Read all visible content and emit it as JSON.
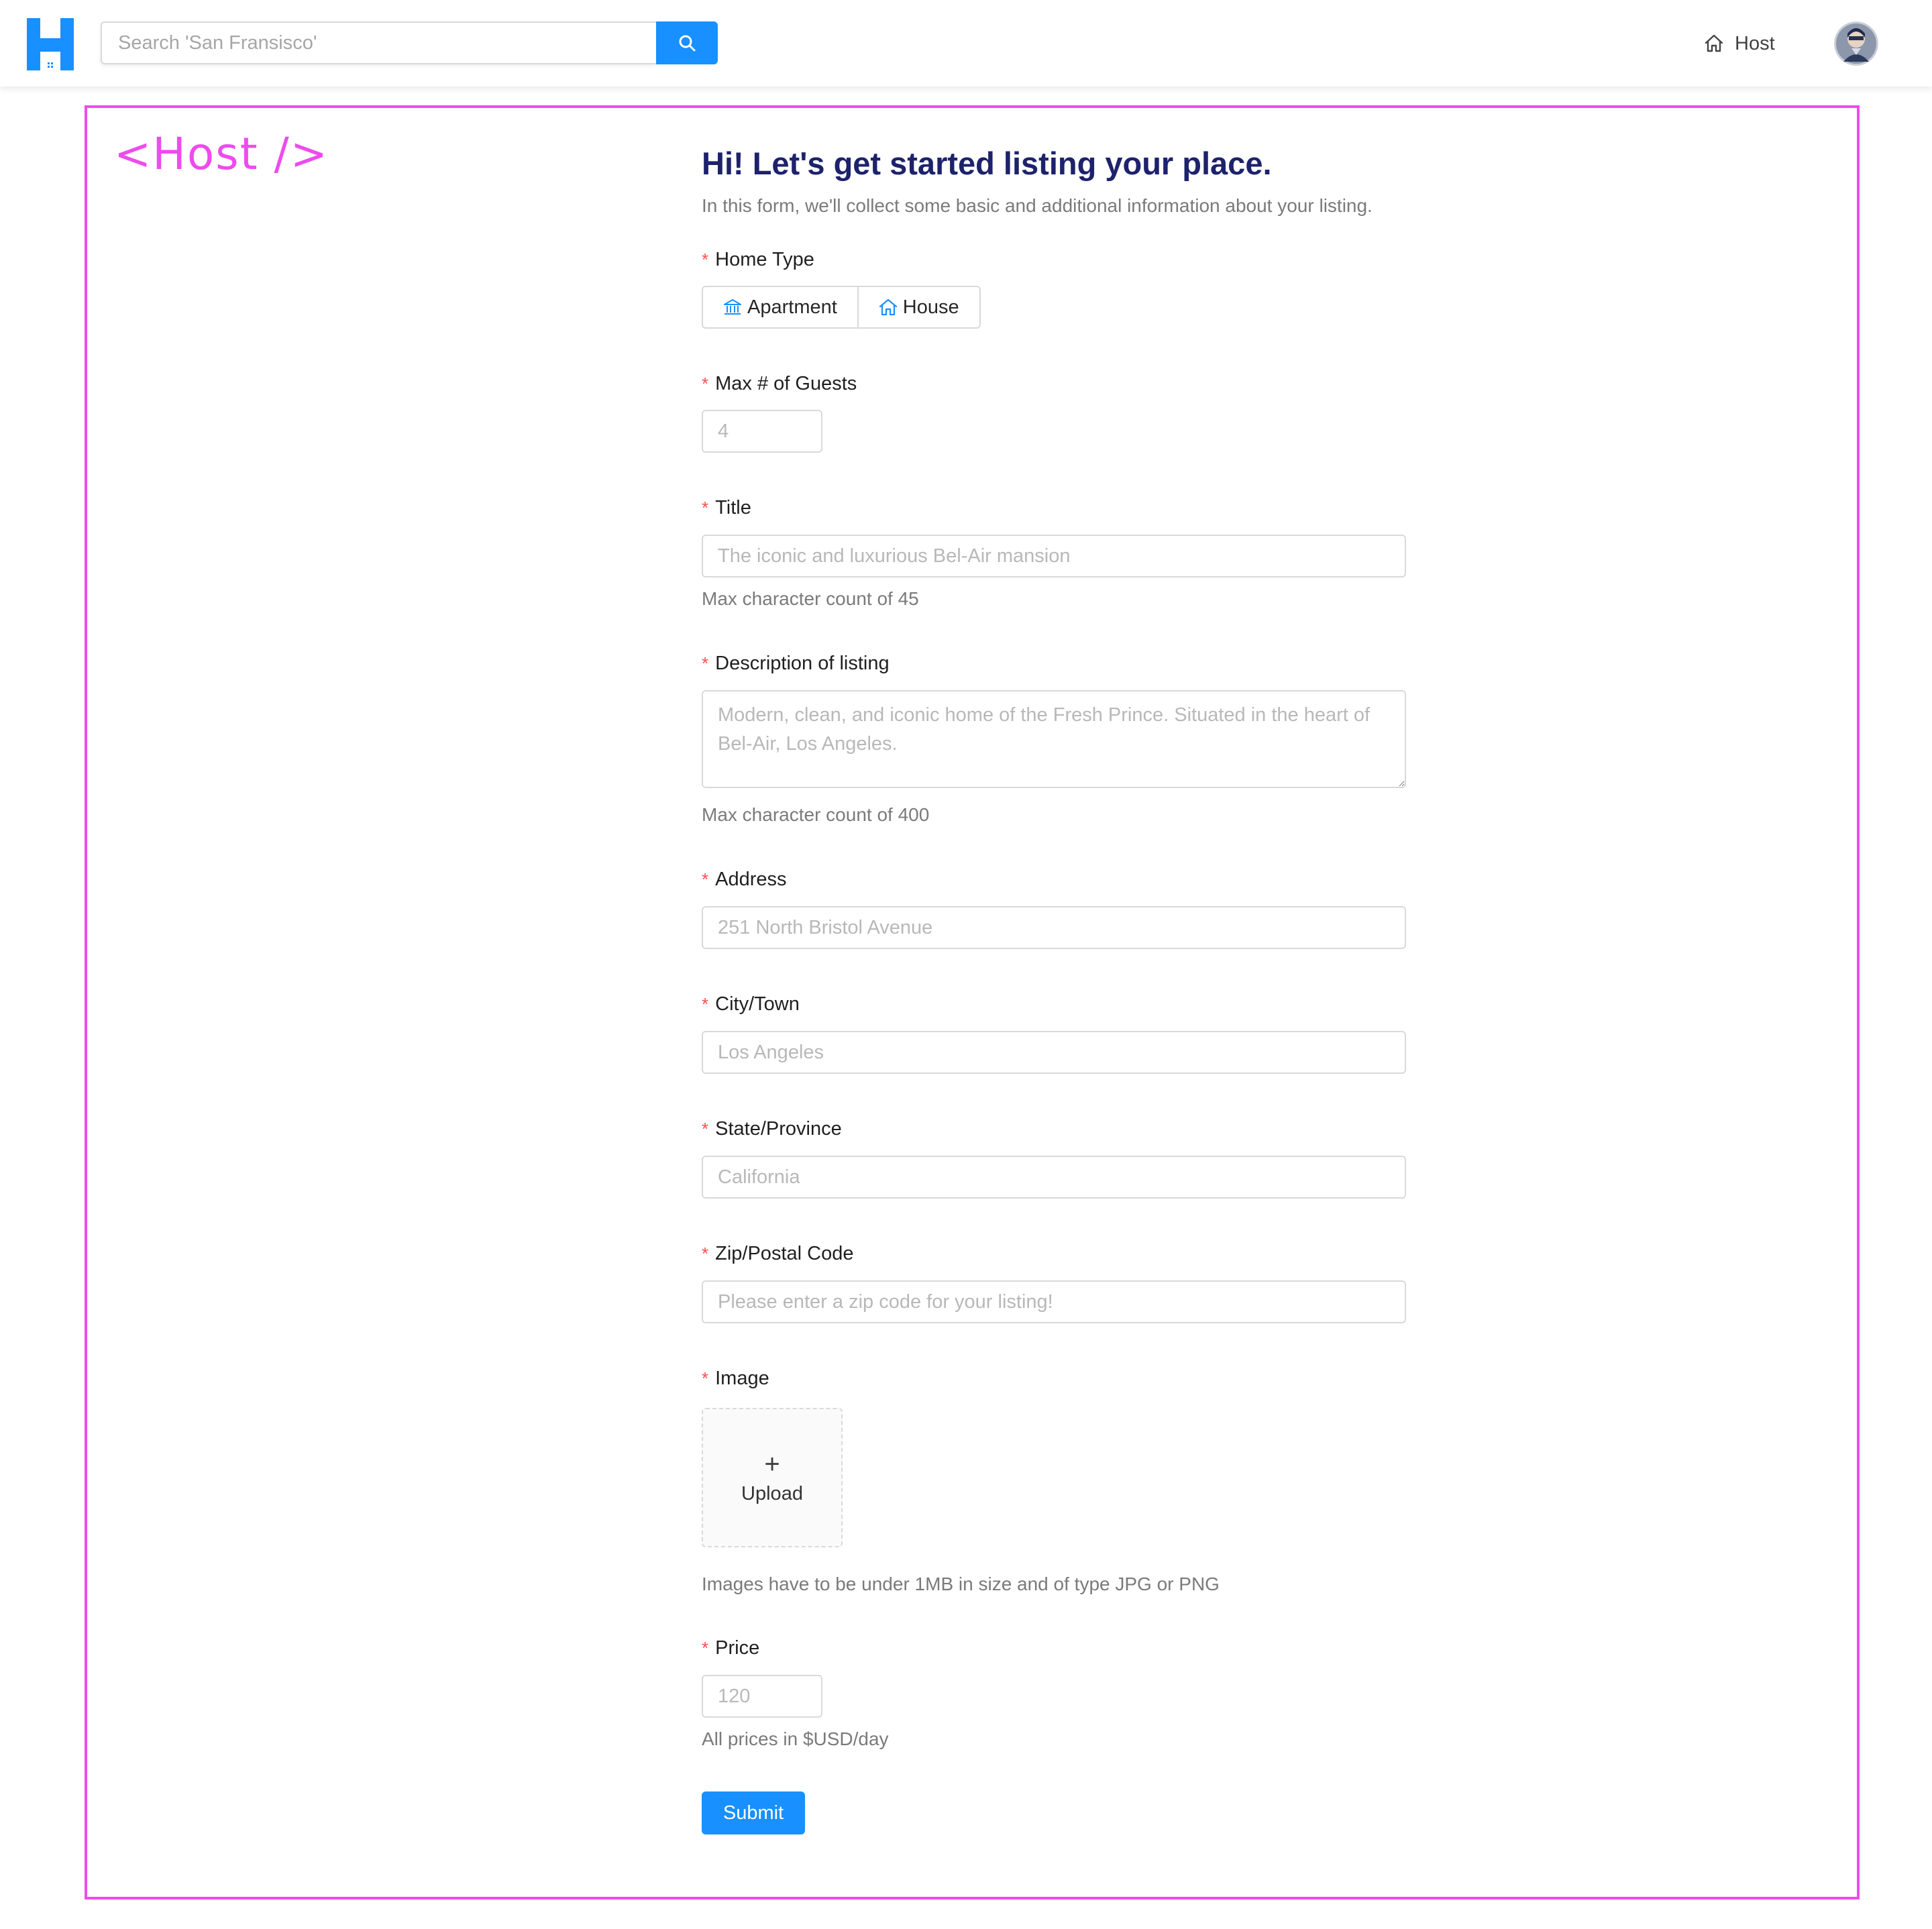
{
  "header": {
    "search": {
      "placeholder": "Search 'San Fransisco'"
    },
    "nav_host_label": "Host",
    "brand_color": "#1890ff"
  },
  "frame": {
    "host_tag": "<Host />",
    "frame_color": "#ee4bee"
  },
  "form": {
    "title": "Hi! Let's get started listing your place.",
    "subtitle": "In this form, we'll collect some basic and additional information about your listing.",
    "required_mark": "*",
    "home_type": {
      "label": "Home Type",
      "options": [
        {
          "label": "Apartment",
          "icon": "bank-icon"
        },
        {
          "label": "House",
          "icon": "home-icon"
        }
      ]
    },
    "guests": {
      "label": "Max # of Guests",
      "placeholder": "4"
    },
    "title_field": {
      "label": "Title",
      "placeholder": "The iconic and luxurious Bel-Air mansion",
      "helper": "Max character count of 45"
    },
    "description": {
      "label": "Description of listing",
      "placeholder": "Modern, clean, and iconic home of the Fresh Prince. Situated in the heart of Bel-Air, Los Angeles.",
      "helper": "Max character count of 400"
    },
    "address": {
      "label": "Address",
      "placeholder": "251 North Bristol Avenue"
    },
    "city": {
      "label": "City/Town",
      "placeholder": "Los Angeles"
    },
    "state": {
      "label": "State/Province",
      "placeholder": "California"
    },
    "zip": {
      "label": "Zip/Postal Code",
      "placeholder": "Please enter a zip code for your listing!"
    },
    "image": {
      "label": "Image",
      "upload_label": "Upload",
      "helper": "Images have to be under 1MB in size and of type JPG or PNG"
    },
    "price": {
      "label": "Price",
      "placeholder": "120",
      "helper": "All prices in $USD/day"
    },
    "submit_label": "Submit"
  }
}
